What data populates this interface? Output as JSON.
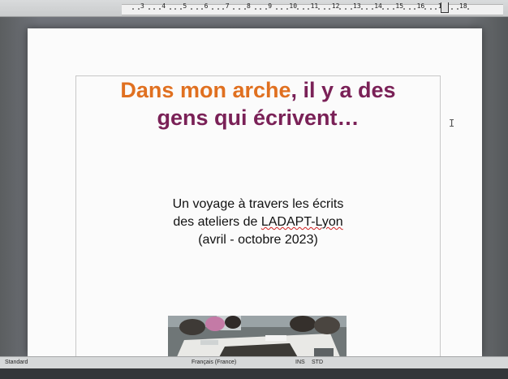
{
  "ruler": {
    "labels": [
      "3",
      "4",
      "5",
      "6",
      "7",
      "8",
      "9",
      "10",
      "11",
      "12",
      "13",
      "14",
      "15",
      "16",
      "17",
      "18"
    ]
  },
  "slide": {
    "title_part1": "Dans mon arche",
    "title_part2": ", il y a des",
    "title_line2": "gens qui écrivent…",
    "subtitle_line1": "Un voyage à travers les écrits",
    "subtitle_line2_pre": "des ateliers de ",
    "subtitle_line2_word": "LADAPT-Lyon",
    "subtitle_line3": "(avril - octobre 2023)"
  },
  "statusbar": {
    "page_style": "Standard",
    "language": "Français (France)",
    "insert_mode": "INS",
    "selection_mode": "STD"
  },
  "colors": {
    "title_orange": "#e07020",
    "title_purple": "#7a2157",
    "spellcheck": "#d02020"
  }
}
